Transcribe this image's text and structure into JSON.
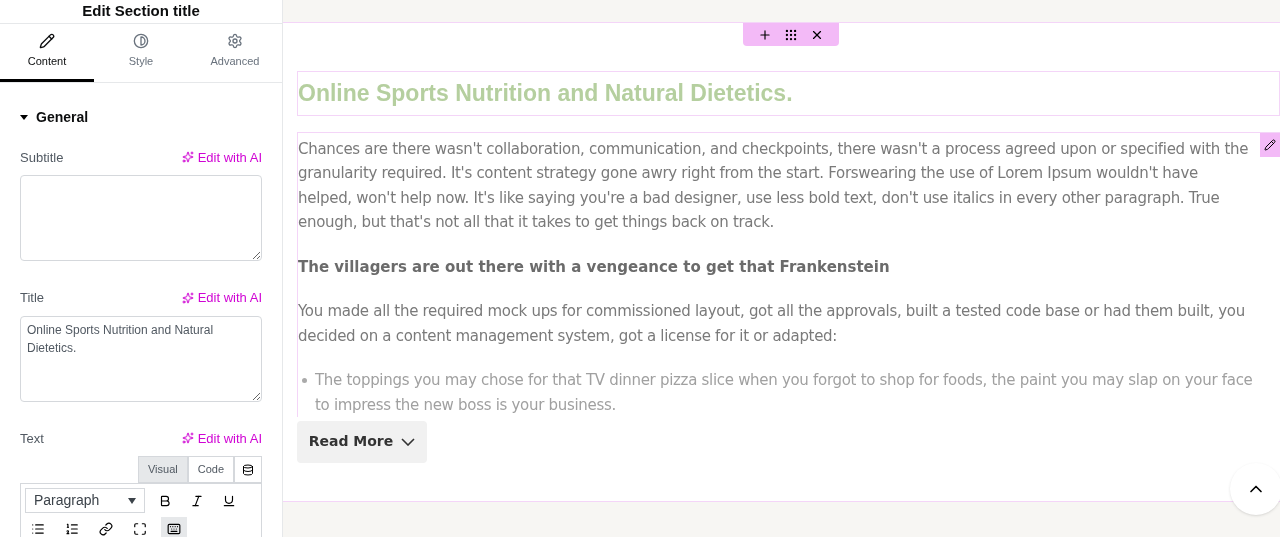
{
  "panel": {
    "title": "Edit Section title",
    "tabs": [
      {
        "label": "Content",
        "selected": true
      },
      {
        "label": "Style",
        "selected": false
      },
      {
        "label": "Advanced",
        "selected": false
      }
    ],
    "section": {
      "label": "General",
      "expanded": true
    },
    "fields": [
      {
        "label": "Subtitle",
        "ai_label": "Edit with AI"
      },
      {
        "label": "Title",
        "ai_label": "Edit with AI",
        "value": "Online Sports Nutrition and Natural Dietetics."
      }
    ],
    "text_field": {
      "label": "Text",
      "ai_label": "Edit with AI",
      "modes": [
        {
          "label": "Visual",
          "selected": true
        },
        {
          "label": "Code",
          "selected": false
        }
      ],
      "format": "Paragraph"
    }
  },
  "canvas": {
    "heading": "Online Sports Nutrition and Natural Dietetics.",
    "paragraphs": [
      {
        "kind": "text",
        "text": "Chances are there wasn't collaboration, communication, and checkpoints, there wasn't a process agreed upon or specified with the granularity required. It's content strategy gone awry right from the start. Forswearing the use of Lorem Ipsum wouldn't have helped, won't help now. It's like saying you're a bad designer, use less bold text, don't use italics in every other paragraph. True enough, but that's not all that it takes to get things back on track."
      },
      {
        "kind": "subheading",
        "text": "The villagers are out there with a vengeance to get that Frankenstein"
      },
      {
        "kind": "text",
        "text": "You made all the required mock ups for commissioned layout, got all the approvals, built a tested code base or had them built, you decided on a content management system, got a license for it or adapted:"
      },
      {
        "kind": "bullet",
        "text": "The toppings you may chose for that TV dinner pizza slice when you forgot to shop for foods, the paint you may slap on your face to impress the new boss is your business."
      }
    ],
    "read_more": "Read More"
  }
}
